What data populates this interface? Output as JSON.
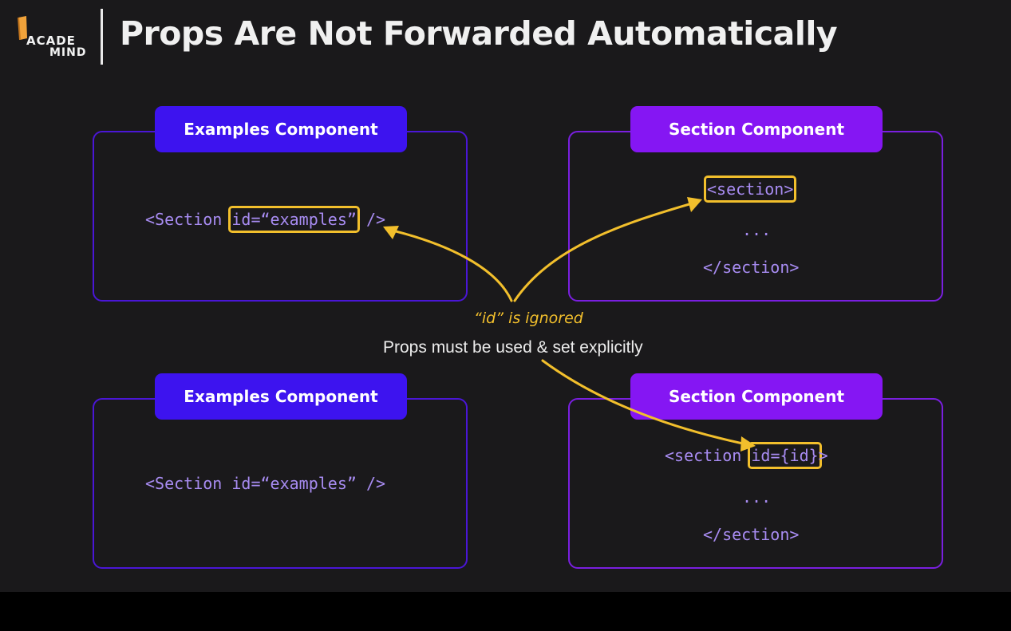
{
  "logo": {
    "line1": "ACADE",
    "line2": "MIND"
  },
  "title": "Props Are Not Forwarded Automatically",
  "colors": {
    "background": "#1a191b",
    "examples_badge": "#3d13ef",
    "section_badge": "#8516f3",
    "panel_border_examples": "#4a16d6",
    "panel_border_section": "#7a1fe0",
    "code_text": "#a88cf2",
    "highlight": "#f2bf2c"
  },
  "top_left": {
    "badge": "Examples Component",
    "code_before": "<Section ",
    "code_highlight": "id=“examples”",
    "code_after": " />"
  },
  "top_right": {
    "badge": "Section Component",
    "open_tag": "<section>",
    "ellipsis": "...",
    "close_tag": "</section>"
  },
  "bottom_left": {
    "badge": "Examples Component",
    "code": "<Section id=“examples” />"
  },
  "bottom_right": {
    "badge": "Section Component",
    "code_before": "<section ",
    "code_highlight": "id={id}",
    "code_after": ">",
    "ellipsis": "...",
    "close_tag": "</section>"
  },
  "annotations": {
    "ignored": "“id” is ignored",
    "explicit": "Props must be used & set explicitly"
  }
}
